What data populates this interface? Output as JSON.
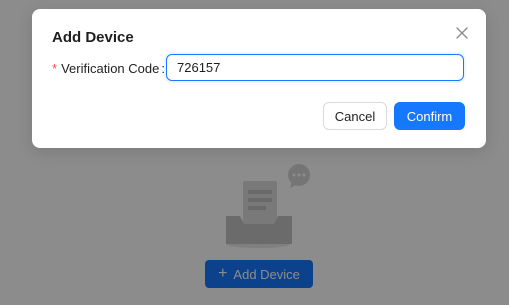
{
  "background": {
    "add_device_button": {
      "label": "Add Device",
      "icon": "plus-icon"
    },
    "empty_illustration": {
      "icon": "empty-inbox-icon"
    }
  },
  "modal": {
    "title": "Add Device",
    "close_icon": "close-icon",
    "field": {
      "required_mark": "*",
      "label": "Verification Code",
      "colon": ":",
      "value": "726157"
    },
    "buttons": {
      "cancel": "Cancel",
      "confirm": "Confirm"
    }
  },
  "colors": {
    "primary": "#1677ff",
    "required": "#ff4d4f",
    "overlay": "rgba(0,0,0,0.45)"
  }
}
